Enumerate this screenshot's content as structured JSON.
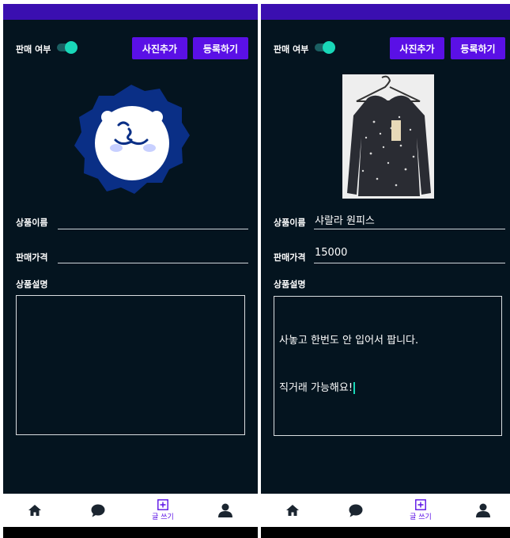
{
  "common": {
    "sale_label": "판매 여부",
    "add_photo_label": "사진추가",
    "register_label": "등록하기",
    "name_label": "상품이름",
    "price_label": "판매가격",
    "desc_label": "상품설명",
    "nav_write_label": "글 쓰기"
  },
  "left": {
    "product_name": "",
    "price": "",
    "description": "",
    "toggle_on": true
  },
  "right": {
    "product_name": "샤랄라 원피스",
    "price": "15000",
    "description_line1": "사놓고 한번도 안 입어서 팝니다.",
    "description_line2": "직거래 가능해요!",
    "toggle_on": true
  },
  "colors": {
    "background": "#04141f",
    "status_bar": "#3a0fb0",
    "accent": "#5a10e6",
    "toggle_on": "#19d7b8"
  },
  "nav_icons": [
    "home-icon",
    "chat-bubble-icon",
    "write-plus-icon",
    "profile-icon"
  ]
}
